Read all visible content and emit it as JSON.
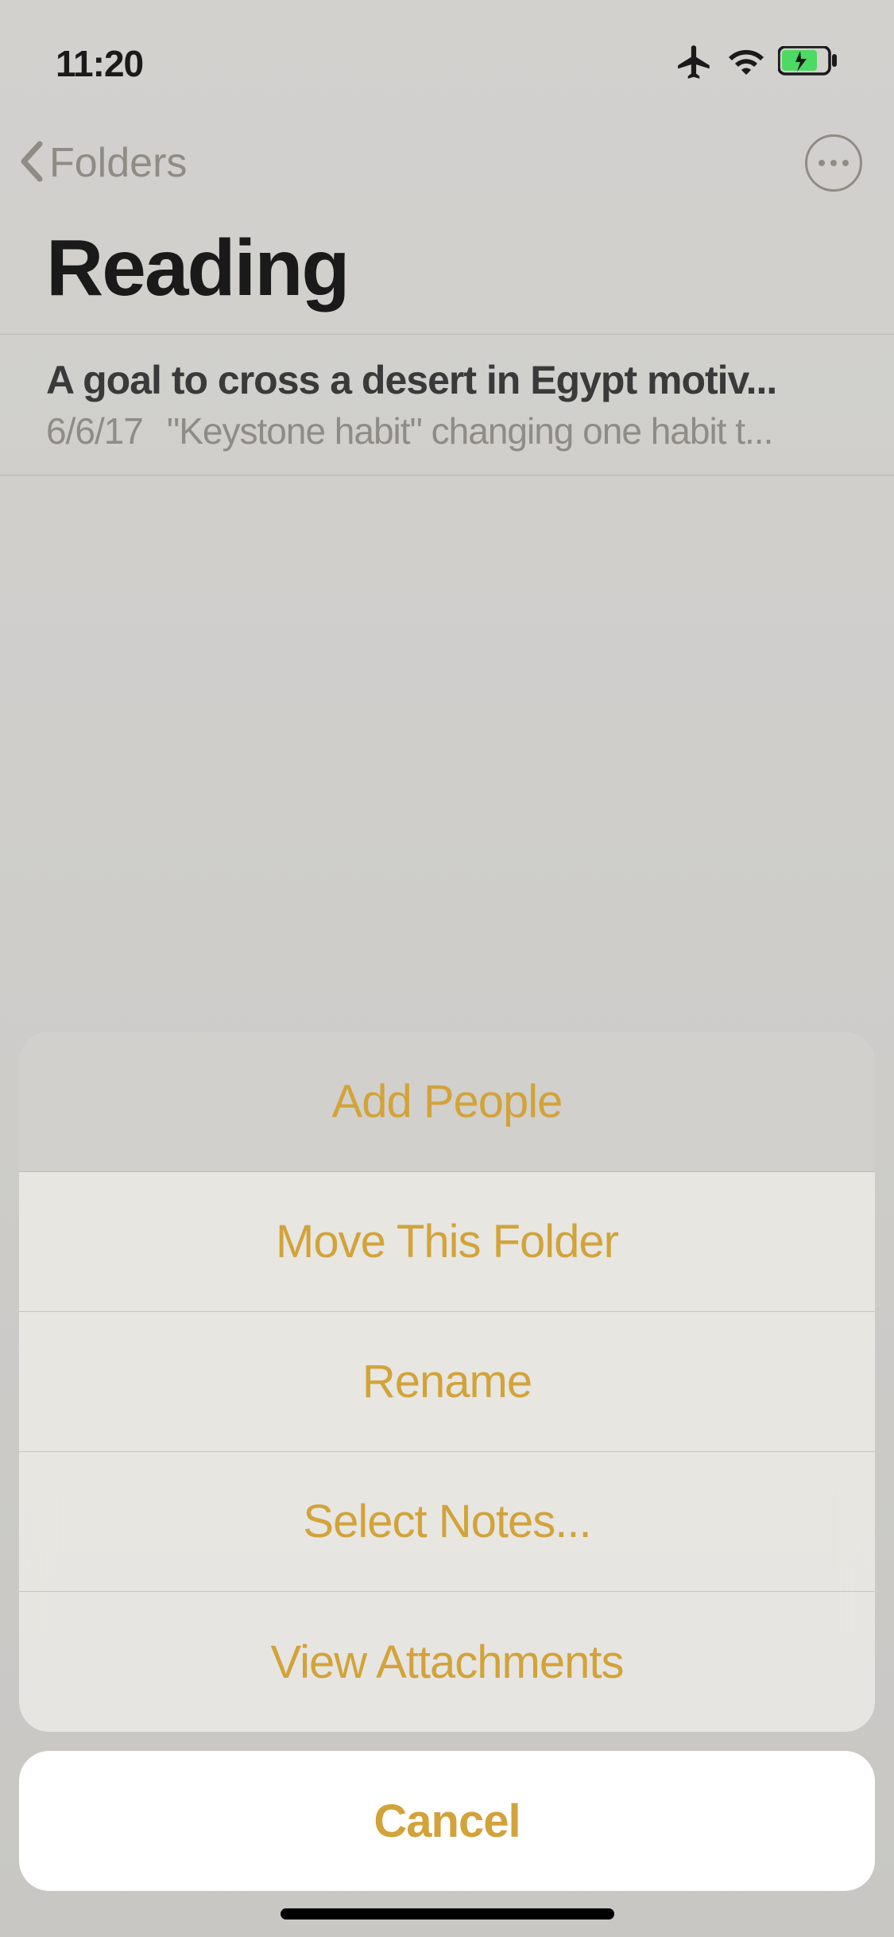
{
  "status": {
    "time": "11:20"
  },
  "nav": {
    "back_label": "Folders"
  },
  "page": {
    "title": "Reading"
  },
  "note": {
    "title": "A goal to cross a desert in Egypt motiv...",
    "date": "6/6/17",
    "preview": "\"Keystone habit\" changing one habit t..."
  },
  "actions": {
    "add_people": "Add People",
    "move_folder": "Move This Folder",
    "rename": "Rename",
    "select_notes": "Select Notes...",
    "view_attachments": "View Attachments",
    "cancel": "Cancel"
  }
}
